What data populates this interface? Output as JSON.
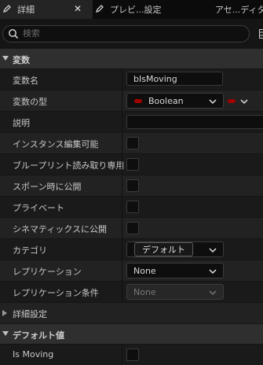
{
  "tabs": [
    {
      "label": "詳細",
      "icon": "pencil-icon"
    },
    {
      "label": "プレビ...設定",
      "icon": "pencil-icon"
    },
    {
      "label": "アセ...ディタ"
    }
  ],
  "search": {
    "placeholder": "検索"
  },
  "categories": {
    "variable": "変数",
    "advanced": "詳細設定",
    "default_value": "デフォルト値"
  },
  "rows": {
    "variable_name": {
      "label": "変数名",
      "value": "bIsMoving"
    },
    "variable_type": {
      "label": "変数の型",
      "value": "Boolean",
      "pin_color": "#a30000"
    },
    "description": {
      "label": "説明",
      "value": ""
    },
    "instance_editable": {
      "label": "インスタンス編集可能",
      "checked": false
    },
    "blueprint_read_only": {
      "label": "ブループリント読み取り専用",
      "checked": false
    },
    "expose_on_spawn": {
      "label": "スポーン時に公開",
      "checked": false
    },
    "private": {
      "label": "プライベート",
      "checked": false
    },
    "expose_to_cinematics": {
      "label": "シネマティックスに公開",
      "checked": false
    },
    "category": {
      "label": "カテゴリ",
      "value": "デフォルト"
    },
    "replication": {
      "label": "レプリケーション",
      "value": "None"
    },
    "replication_condition": {
      "label": "レプリケーション条件",
      "value": "None"
    },
    "is_moving": {
      "label": "Is Moving",
      "checked": false
    }
  }
}
